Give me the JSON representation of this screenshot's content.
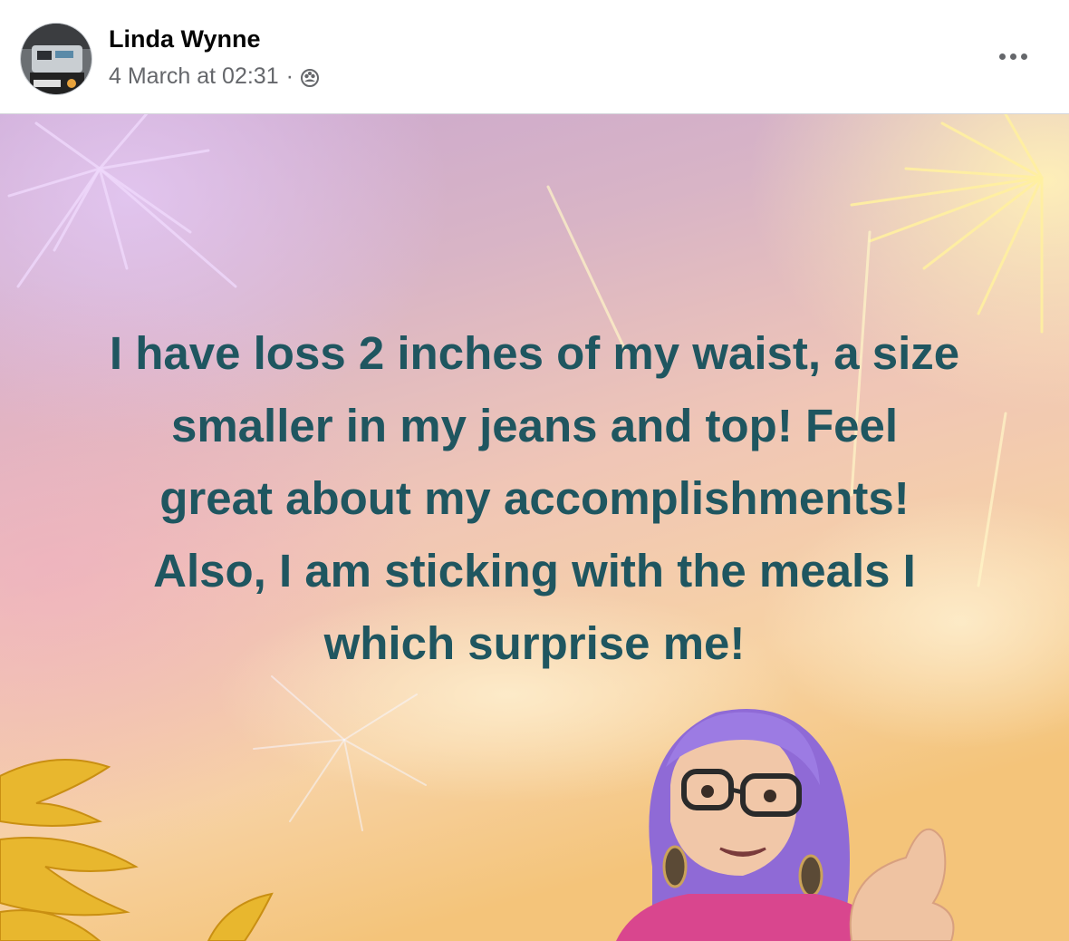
{
  "post": {
    "author": "Linda Wynne",
    "timestamp": "4 March at 02:31",
    "separator": "·",
    "audience_icon": "friends-icon",
    "more_icon": "more-options-icon",
    "text_lines": [
      "I have loss 2 inches of my waist, a size",
      "smaller in my jeans and top! Feel",
      "great about my accomplishments!",
      "Also, I am sticking with the meals I",
      "which surprise me!"
    ],
    "text_color": "#1f5660",
    "background": "fireworks-sunset-gradient"
  }
}
